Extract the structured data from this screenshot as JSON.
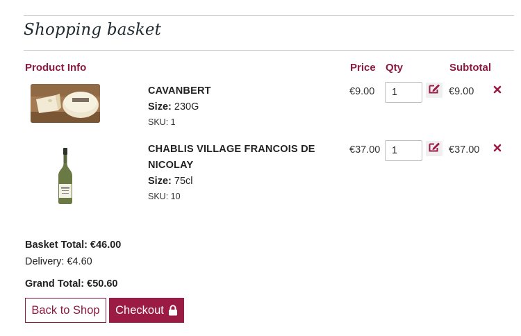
{
  "page": {
    "title": "Shopping basket"
  },
  "table": {
    "headers": {
      "product_info": "Product Info",
      "price": "Price",
      "qty": "Qty",
      "subtotal": "Subtotal"
    }
  },
  "items": [
    {
      "name": "CAVANBERT",
      "size_label": "Size:",
      "size": "230G",
      "sku": "SKU: 1",
      "price": "€9.00",
      "qty": "1",
      "subtotal": "€9.00"
    },
    {
      "name_line1": "CHABLIS VILLAGE FRANCOIS DE",
      "name_line2": "NICOLAY",
      "size_label": "Size:",
      "size": "75cl",
      "sku": "SKU: 10",
      "price": "€37.00",
      "qty": "1",
      "subtotal": "€37.00"
    }
  ],
  "totals": {
    "basket_total": "Basket Total: €46.00",
    "delivery": "Delivery: €4.60",
    "grand_total": "Grand Total: €50.60"
  },
  "actions": {
    "back_label": "Back to Shop",
    "checkout_label": "Checkout"
  },
  "icons": {
    "edit": "edit-icon",
    "remove": "close-icon",
    "lock": "lock-icon"
  },
  "colors": {
    "accent": "#9b1b45",
    "heading": "#8c1a3f",
    "rule": "#cfcfcf"
  }
}
